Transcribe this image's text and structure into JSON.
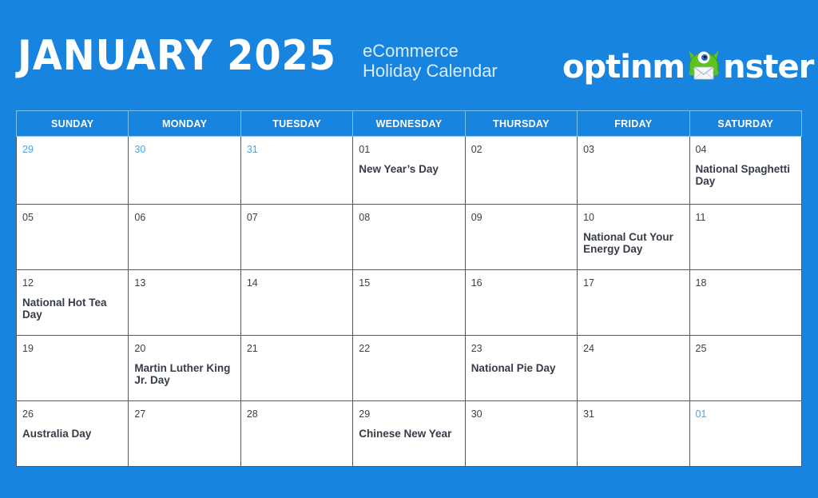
{
  "header": {
    "title": "JANUARY 2025",
    "subtitle_line1": "eCommerce",
    "subtitle_line2": "Holiday Calendar",
    "logo_text_before": "optinm",
    "logo_text_after": "nster",
    "logo_mascot": "monster-mascot-icon"
  },
  "colors": {
    "background": "#1784e0",
    "header_text": "#ffffff",
    "other_month_day": "#4fa3e8",
    "event_text": "#363c47",
    "mascot_green": "#5cc21f"
  },
  "calendar": {
    "weekdays": [
      "SUNDAY",
      "MONDAY",
      "TUESDAY",
      "WEDNESDAY",
      "THURSDAY",
      "FRIDAY",
      "SATURDAY"
    ],
    "weeks": [
      [
        {
          "day": "29",
          "other_month": true,
          "event": ""
        },
        {
          "day": "30",
          "other_month": true,
          "event": ""
        },
        {
          "day": "31",
          "other_month": true,
          "event": ""
        },
        {
          "day": "01",
          "other_month": false,
          "event": "New Year’s Day"
        },
        {
          "day": "02",
          "other_month": false,
          "event": ""
        },
        {
          "day": "03",
          "other_month": false,
          "event": ""
        },
        {
          "day": "04",
          "other_month": false,
          "event": "National Spaghetti Day"
        }
      ],
      [
        {
          "day": "05",
          "other_month": false,
          "event": ""
        },
        {
          "day": "06",
          "other_month": false,
          "event": ""
        },
        {
          "day": "07",
          "other_month": false,
          "event": ""
        },
        {
          "day": "08",
          "other_month": false,
          "event": ""
        },
        {
          "day": "09",
          "other_month": false,
          "event": ""
        },
        {
          "day": "10",
          "other_month": false,
          "event": "National Cut Your Energy Day"
        },
        {
          "day": "11",
          "other_month": false,
          "event": ""
        }
      ],
      [
        {
          "day": "12",
          "other_month": false,
          "event": "National Hot Tea Day"
        },
        {
          "day": "13",
          "other_month": false,
          "event": ""
        },
        {
          "day": "14",
          "other_month": false,
          "event": ""
        },
        {
          "day": "15",
          "other_month": false,
          "event": ""
        },
        {
          "day": "16",
          "other_month": false,
          "event": ""
        },
        {
          "day": "17",
          "other_month": false,
          "event": ""
        },
        {
          "day": "18",
          "other_month": false,
          "event": ""
        }
      ],
      [
        {
          "day": "19",
          "other_month": false,
          "event": ""
        },
        {
          "day": "20",
          "other_month": false,
          "event": "Martin Luther King Jr. Day"
        },
        {
          "day": "21",
          "other_month": false,
          "event": ""
        },
        {
          "day": "22",
          "other_month": false,
          "event": ""
        },
        {
          "day": "23",
          "other_month": false,
          "event": "National Pie Day"
        },
        {
          "day": "24",
          "other_month": false,
          "event": ""
        },
        {
          "day": "25",
          "other_month": false,
          "event": ""
        }
      ],
      [
        {
          "day": "26",
          "other_month": false,
          "event": "Australia Day"
        },
        {
          "day": "27",
          "other_month": false,
          "event": ""
        },
        {
          "day": "28",
          "other_month": false,
          "event": ""
        },
        {
          "day": "29",
          "other_month": false,
          "event": "Chinese New Year"
        },
        {
          "day": "30",
          "other_month": false,
          "event": ""
        },
        {
          "day": "31",
          "other_month": false,
          "event": ""
        },
        {
          "day": "01",
          "other_month": true,
          "event": ""
        }
      ]
    ]
  }
}
